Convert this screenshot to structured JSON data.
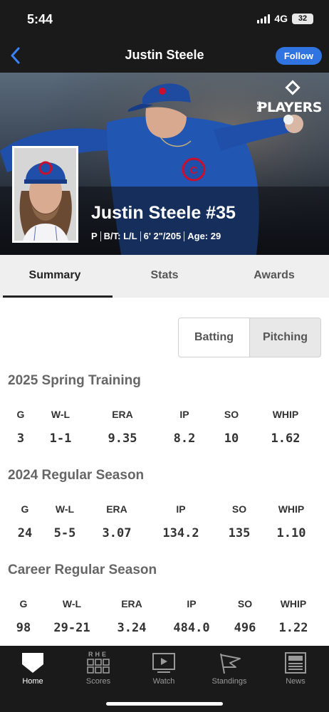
{
  "status_bar": {
    "time": "5:44",
    "network": "4G",
    "battery": "32"
  },
  "nav": {
    "title": "Justin Steele",
    "follow_label": "Follow"
  },
  "hero": {
    "logo_word": "PLAYERS",
    "logo_small": "MLB",
    "player_name": "Justin Steele #35",
    "position": "P",
    "bats_throws": "B/T: L/L",
    "height_weight": "6' 2\"/205",
    "age": "Age: 29"
  },
  "tabs": [
    {
      "label": "Summary",
      "active": true
    },
    {
      "label": "Stats",
      "active": false
    },
    {
      "label": "Awards",
      "active": false
    }
  ],
  "toggle": {
    "batting": "Batting",
    "pitching": "Pitching",
    "selected": "Pitching"
  },
  "stat_headers": [
    "G",
    "W-L",
    "ERA",
    "IP",
    "SO",
    "WHIP"
  ],
  "sections": [
    {
      "title": "2025 Spring Training",
      "values": [
        "3",
        "1-1",
        "9.35",
        "8.2",
        "10",
        "1.62"
      ]
    },
    {
      "title": "2024 Regular Season",
      "values": [
        "24",
        "5-5",
        "3.07",
        "134.2",
        "135",
        "1.10"
      ]
    },
    {
      "title": "Career Regular Season",
      "values": [
        "98",
        "29-21",
        "3.24",
        "484.0",
        "496",
        "1.22"
      ]
    }
  ],
  "bottom_nav": [
    {
      "label": "Home",
      "icon": "home-plate-icon",
      "active": true
    },
    {
      "label": "Scores",
      "icon": "scoreboard-icon",
      "scoreboard_letters": "RHE",
      "active": false
    },
    {
      "label": "Watch",
      "icon": "play-screen-icon",
      "active": false
    },
    {
      "label": "Standings",
      "icon": "pennant-flag-icon",
      "active": false
    },
    {
      "label": "News",
      "icon": "newspaper-icon",
      "active": false
    }
  ],
  "colors": {
    "accent": "#2f74e0",
    "dark_bar": "#1a1a1a",
    "tab_bg": "#efefef",
    "cubs_blue": "#1f4fa8"
  }
}
